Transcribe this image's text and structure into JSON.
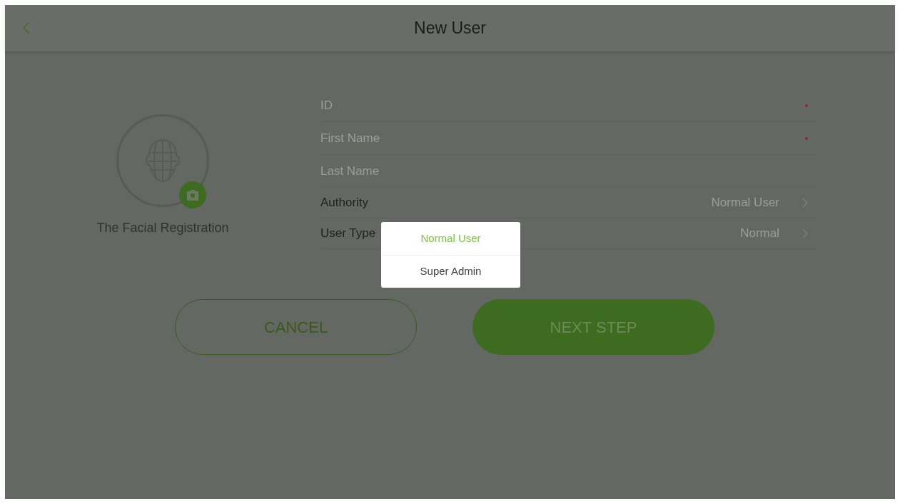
{
  "header": {
    "title": "New User"
  },
  "face": {
    "caption": "The Facial Registration"
  },
  "fields": [
    {
      "kind": "input",
      "placeholder": "ID",
      "required": true
    },
    {
      "kind": "input",
      "placeholder": "First Name",
      "required": true
    },
    {
      "kind": "input",
      "placeholder": "Last Name",
      "required": false
    },
    {
      "kind": "select",
      "label": "Authority",
      "value": "Normal User"
    },
    {
      "kind": "select",
      "label": "User Type",
      "value": "Normal"
    }
  ],
  "buttons": [
    {
      "label": "CANCEL",
      "kind": "outline"
    },
    {
      "label": "NEXT STEP",
      "kind": "primary"
    }
  ],
  "menu": {
    "options": [
      {
        "label": "Normal User",
        "selected": true
      },
      {
        "label": "Super Admin",
        "selected": false
      }
    ]
  }
}
